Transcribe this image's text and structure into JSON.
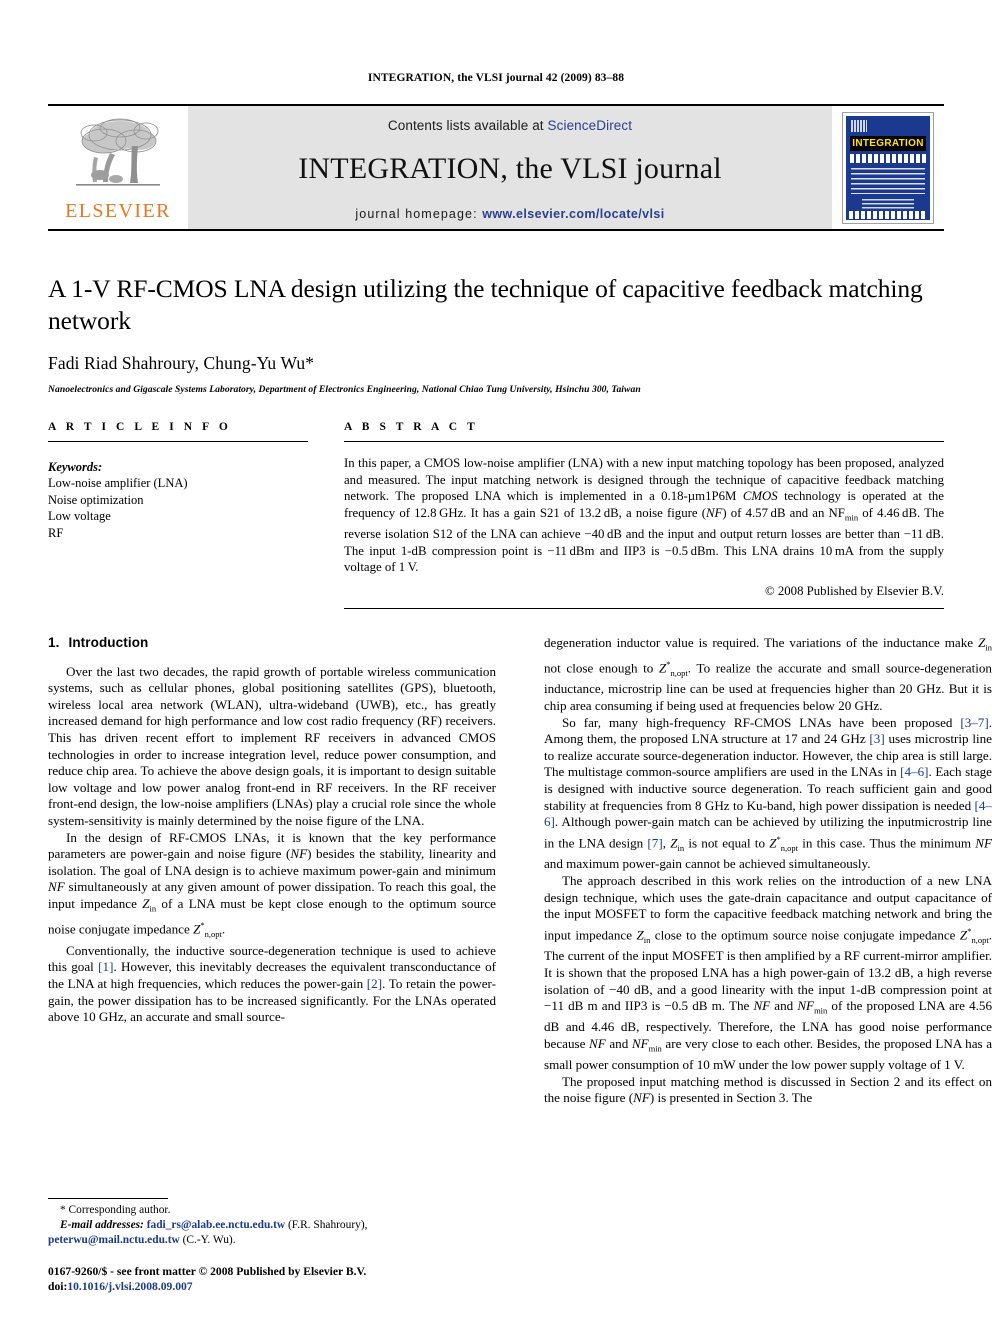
{
  "running_head": "INTEGRATION, the VLSI journal 42 (2009) 83–88",
  "masthead": {
    "contents_prefix": "Contents lists available at ",
    "sciencedirect": "ScienceDirect",
    "journal_title": "INTEGRATION, the VLSI journal",
    "homepage_prefix": "journal homepage: ",
    "homepage_url": "www.elsevier.com/locate/vlsi",
    "publisher_wordmark": "ELSEVIER",
    "cover_banner": "INTEGRATION",
    "link_color": "#2b3f8c",
    "band_color": "#e3e3e3",
    "elsevier_orange": "#E87722"
  },
  "article": {
    "title": "A 1-V RF-CMOS LNA design utilizing the technique of capacitive feedback matching network",
    "authors": "Fadi Riad Shahroury, Chung-Yu Wu*",
    "affiliation": "Nanoelectronics and Gigascale Systems Laboratory, Department of Electronics Engineering, National Chiao Tung University, Hsinchu 300, Taiwan"
  },
  "article_info": {
    "heading": "A R T I C L E   I N F O",
    "keywords_label": "Keywords:",
    "keywords": [
      "Low-noise amplifier (LNA)",
      "Noise optimization",
      "Low voltage",
      "RF"
    ]
  },
  "abstract": {
    "heading": "A B S T R A C T",
    "text": "In this paper, a CMOS low-noise amplifier (LNA) with a new input matching topology has been proposed, analyzed and measured. The input matching network is designed through the technique of capacitive feedback matching network. The proposed LNA which is implemented in a 0.18-μm1P6M CMOS technology is operated at the frequency of 12.8 GHz. It has a gain S21 of 13.2 dB, a noise figure (NF) of 4.57 dB and an NFmin of 4.46 dB. The reverse isolation S12 of the LNA can achieve −40 dB and the input and output return losses are better than −11 dB. The input 1-dB compression point is −11 dBm and IIP3 is −0.5 dBm. This LNA drains 10 mA from the supply voltage of 1 V.",
    "copyright": "© 2008 Published by Elsevier B.V."
  },
  "sections": {
    "intro_number": "1.",
    "intro_title": "Introduction"
  },
  "body": {
    "left_p1": "Over the last two decades, the rapid growth of portable wireless communication systems, such as cellular phones, global positioning satellites (GPS), bluetooth, wireless local area network (WLAN), ultra-wideband (UWB), etc., has greatly increased demand for high performance and low cost radio frequency (RF) receivers. This has driven recent effort to implement RF receivers in advanced CMOS technologies in order to increase integration level, reduce power consumption, and reduce chip area. To achieve the above design goals, it is important to design suitable low voltage and low power analog front-end in RF receivers. In the RF receiver front-end design, the low-noise amplifiers (LNAs) play a crucial role since the whole system-sensitivity is mainly determined by the noise figure of the LNA.",
    "left_p2_a": "In the design of RF-CMOS LNAs, it is known that the key performance parameters are power-gain and noise figure (",
    "left_p2_nf": "NF",
    "left_p2_b": ") besides the stability, linearity and isolation. The goal of LNA design is to achieve maximum power-gain and minimum ",
    "left_p2_nf2": "NF",
    "left_p2_c": " simultaneously at any given amount of power dissipation. To reach this goal, the input impedance ",
    "left_p2_zin": "Z",
    "left_p2_zin_sub": "in",
    "left_p2_d": " of a LNA must be kept close enough to the optimum source noise conjugate impedance ",
    "left_p2_zopt": "Z",
    "left_p2_zopt_sup": "*",
    "left_p2_zopt_sub": "n,opt",
    "left_p2_e": ".",
    "left_p3_a": "Conventionally, the inductive source-degeneration technique is used to achieve this goal ",
    "left_p3_ref1": "[1]",
    "left_p3_b": ". However, this inevitably decreases the equivalent transconductance of the LNA at high frequencies, which reduces the power-gain ",
    "left_p3_ref2": "[2]",
    "left_p3_c": ". To retain the power-gain, the power dissipation has to be increased significantly. For the LNAs operated above 10 GHz, an accurate and small source-",
    "right_p1_a": "degeneration inductor value is required. The variations of the inductance make ",
    "right_p1_zin": "Z",
    "right_p1_zin_sub": "in",
    "right_p1_b": " not close enough to ",
    "right_p1_zopt": "Z",
    "right_p1_zopt_sup": "*",
    "right_p1_zopt_sub": "n,opt",
    "right_p1_c": ". To realize the accurate and small source-degeneration inductance, microstrip line can be used at frequencies higher than 20 GHz. But it is chip area consuming if being used at frequencies below 20 GHz.",
    "right_p2_a": "So far, many high-frequency RF-CMOS LNAs have been proposed ",
    "right_p2_ref1": "[3–7]",
    "right_p2_b": ". Among them, the proposed LNA structure at 17 and 24 GHz ",
    "right_p2_ref2": "[3]",
    "right_p2_c": " uses microstrip line to realize accurate source-degeneration inductor. However, the chip area is still large. The multistage common-source amplifiers are used in the LNAs in ",
    "right_p2_ref3": "[4–6]",
    "right_p2_d": ". Each stage is designed with inductive source degeneration. To reach sufficient gain and good stability at frequencies from 8 GHz to Ku-band, high power dissipation is needed ",
    "right_p2_ref4": "[4–6]",
    "right_p2_e": ". Although power-gain match can be achieved by utilizing the inputmicrostrip line in the LNA design ",
    "right_p2_ref5": "[7]",
    "right_p2_f": ", ",
    "right_p2_zin": "Z",
    "right_p2_zin_sub": "in",
    "right_p2_g": " is not equal to ",
    "right_p2_zopt": "Z",
    "right_p2_zopt_sup": "*",
    "right_p2_zopt_sub": "n,opt",
    "right_p2_h": " in this case. Thus the minimum ",
    "right_p2_nf": "NF",
    "right_p2_i": " and maximum power-gain cannot be achieved simultaneously.",
    "right_p3_a": "The approach described in this work relies on the introduction of a new LNA design technique, which uses the gate-drain capacitance and output capacitance of the input MOSFET to form the capacitive feedback matching network and bring the input impedance ",
    "right_p3_zin": "Z",
    "right_p3_zin_sub": "in",
    "right_p3_b": " close to the optimum source noise conjugate impedance ",
    "right_p3_zopt": "Z",
    "right_p3_zopt_sup": "*",
    "right_p3_zopt_sub": "n,opt",
    "right_p3_c": ". The current of the input MOSFET is then amplified by a RF current-mirror amplifier. It is shown that the proposed LNA has a high power-gain of 13.2 dB, a high reverse isolation of −40 dB, and a good linearity with the input 1-dB compression point at −11 dB m and IIP3 is −0.5 dB m. The ",
    "right_p3_nf1": "NF",
    "right_p3_d": " and ",
    "right_p3_nf2": "NF",
    "right_p3_nf2_sub": "min",
    "right_p3_e": " of the proposed LNA are 4.56 dB and 4.46 dB, respectively. Therefore, the LNA has good noise performance because ",
    "right_p3_nf3": "NF",
    "right_p3_f": " and ",
    "right_p3_nf4": "NF",
    "right_p3_nf4_sub": "min",
    "right_p3_g": " are very close to each other. Besides, the proposed LNA has a small power consumption of 10 mW under the low power supply voltage of 1 V.",
    "right_p4_a": "The proposed input matching method is discussed in Section 2 and its effect on the noise figure (",
    "right_p4_nf": "NF",
    "right_p4_b": ") is presented in Section 3. The"
  },
  "footnotes": {
    "corresponding": "* Corresponding author.",
    "email_label": "E-mail addresses:",
    "email1": "fadi_rs@alab.ee.nctu.edu.tw",
    "email1_owner": " (F.R. Shahroury),",
    "email2": "peterwu@mail.nctu.edu.tw",
    "email2_owner": " (C.-Y. Wu).",
    "imprint_line1": "0167-9260/$ - see front matter © 2008 Published by Elsevier B.V.",
    "imprint_doi_label": "doi:",
    "imprint_doi": "10.1016/j.vlsi.2008.09.007"
  }
}
